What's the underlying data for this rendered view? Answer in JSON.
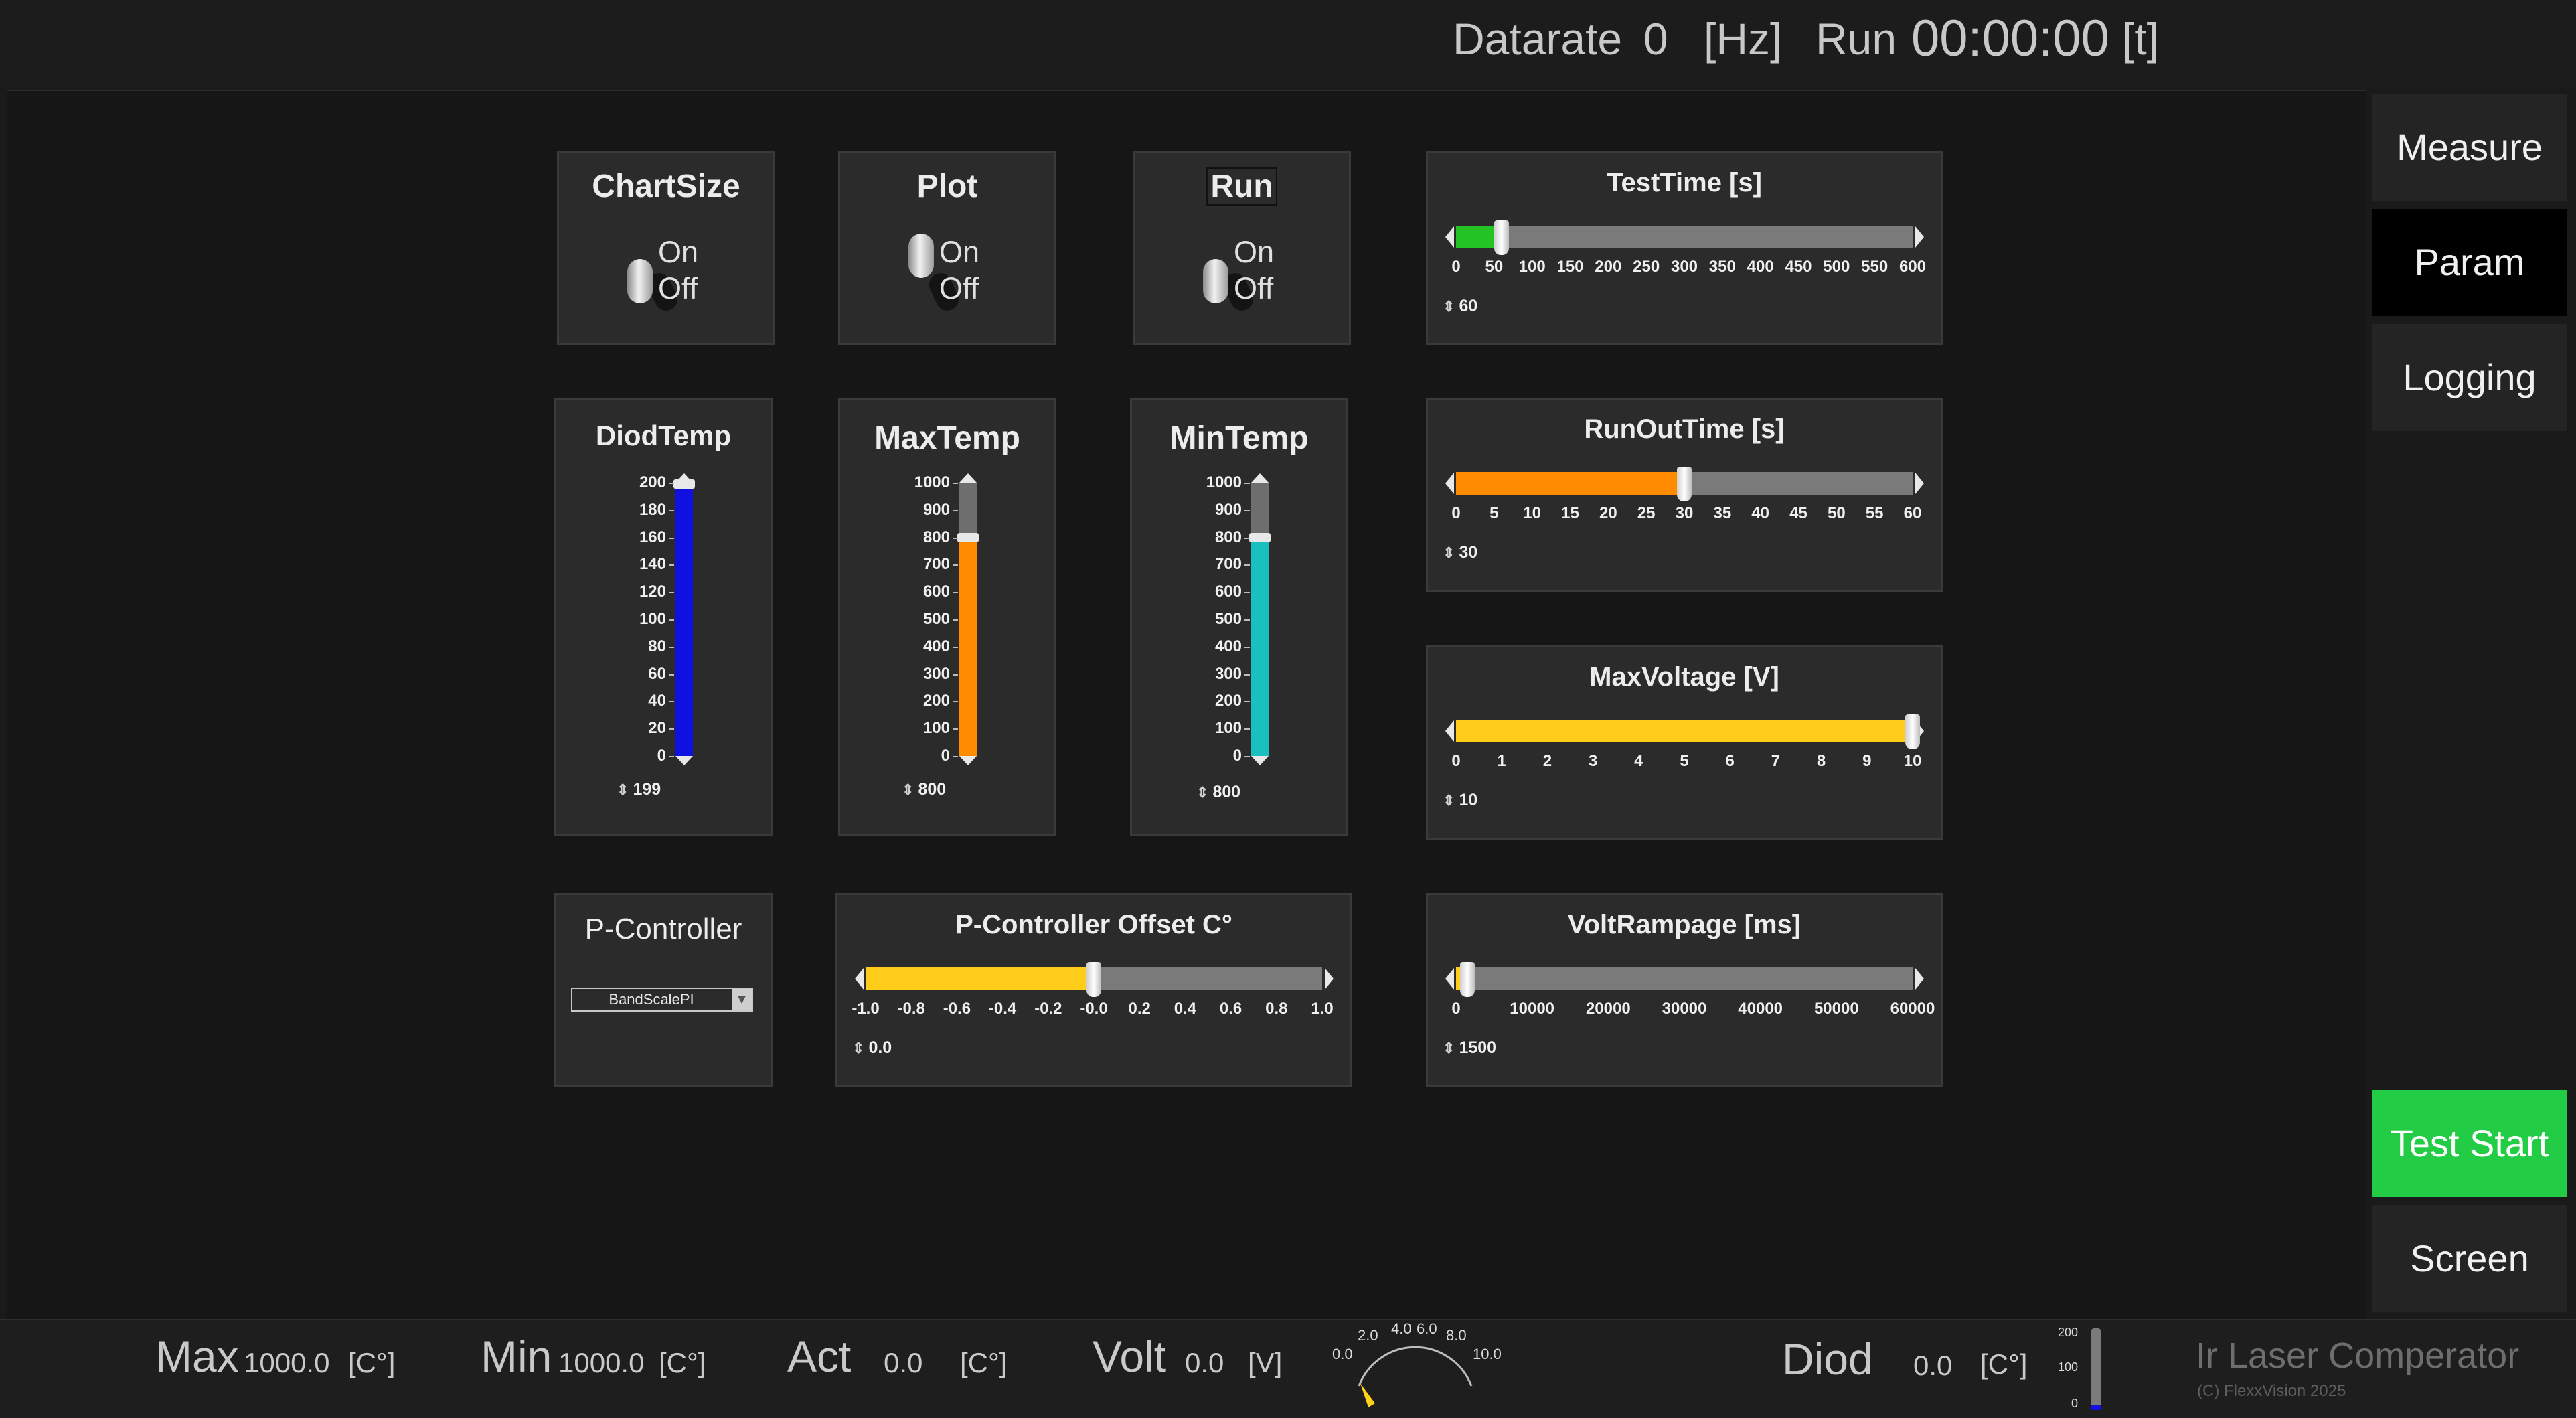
{
  "topbar": {
    "datarate_label": "Datarate",
    "datarate_value": "0",
    "datarate_unit": "[Hz]",
    "run_label": "Run",
    "run_value": "00:00:00",
    "run_unit": "[t]"
  },
  "switches": [
    {
      "title": "ChartSize",
      "on": "On",
      "off": "Off",
      "state": "off"
    },
    {
      "title": "Plot",
      "on": "On",
      "off": "Off",
      "state": "off"
    },
    {
      "title": "Run",
      "on": "On",
      "off": "Off",
      "state": "off"
    }
  ],
  "vbars": [
    {
      "title": "DiodTemp",
      "ticks": [
        "200",
        "180",
        "160",
        "140",
        "120",
        "100",
        "80",
        "60",
        "40",
        "20",
        "0"
      ],
      "min": 0,
      "max": 200,
      "value": 199,
      "value_label": "199",
      "color": "#1010e0"
    },
    {
      "title": "MaxTemp",
      "ticks": [
        "1000",
        "900",
        "800",
        "700",
        "600",
        "500",
        "400",
        "300",
        "200",
        "100",
        "0"
      ],
      "min": 0,
      "max": 1000,
      "value": 800,
      "value_label": "800",
      "color": "#ff8c00"
    },
    {
      "title": "MinTemp",
      "ticks": [
        "1000",
        "900",
        "800",
        "700",
        "600",
        "500",
        "400",
        "300",
        "200",
        "100",
        "0"
      ],
      "min": 0,
      "max": 1000,
      "value": 800,
      "value_label": "800",
      "color": "#1abfbf"
    }
  ],
  "sliders": {
    "testtime": {
      "title": "TestTime [s]",
      "ticks": [
        "0",
        "50",
        "100",
        "150",
        "200",
        "250",
        "300",
        "350",
        "400",
        "450",
        "500",
        "550",
        "600"
      ],
      "min": 0,
      "max": 600,
      "value": 60,
      "value_label": "60",
      "color": "#22c322"
    },
    "runout": {
      "title": "RunOutTime [s]",
      "ticks": [
        "0",
        "5",
        "10",
        "15",
        "20",
        "25",
        "30",
        "35",
        "40",
        "45",
        "50",
        "55",
        "60"
      ],
      "min": 0,
      "max": 60,
      "value": 30,
      "value_label": "30",
      "color": "#ff8c00"
    },
    "maxvolt": {
      "title": "MaxVoltage [V]",
      "ticks": [
        "0",
        "1",
        "2",
        "3",
        "4",
        "5",
        "6",
        "7",
        "8",
        "9",
        "10"
      ],
      "min": 0,
      "max": 10,
      "value": 10,
      "value_label": "10",
      "color": "#ffcc1a"
    },
    "offset": {
      "title": "P-Controller Offset C°",
      "ticks": [
        "-1.0",
        "-0.8",
        "-0.6",
        "-0.4",
        "-0.2",
        "-0.0",
        "0.2",
        "0.4",
        "0.6",
        "0.8",
        "1.0"
      ],
      "min": -1,
      "max": 1,
      "value": 0,
      "value_label": "0.0",
      "color": "#ffcc1a"
    },
    "voltramp": {
      "title": "VoltRampage [ms]",
      "ticks": [
        "0",
        "10000",
        "20000",
        "30000",
        "40000",
        "50000",
        "60000"
      ],
      "min": 0,
      "max": 60000,
      "value": 1500,
      "value_label": "1500",
      "color": "#ffcc1a"
    }
  },
  "pcontroller": {
    "title": "P-Controller",
    "selected": "BandScalePI"
  },
  "nav": {
    "measure": "Measure",
    "param": "Param",
    "logging": "Logging",
    "test_start": "Test Start",
    "screen": "Screen"
  },
  "bottom": {
    "max_label": "Max",
    "max_value": "1000.0",
    "max_unit": "[C°]",
    "min_label": "Min",
    "min_value": "1000.0",
    "min_unit": "[C°]",
    "act_label": "Act",
    "act_value": "0.0",
    "act_unit": "[C°]",
    "volt_label": "Volt",
    "volt_value": "0.0",
    "volt_unit": "[V]",
    "gauge_ticks": [
      "0.0",
      "2.0",
      "4.0",
      "6.0",
      "8.0",
      "10.0"
    ],
    "diod_label": "Diod",
    "diod_value": "0.0",
    "diod_unit": "[C°]",
    "mini_ticks": [
      "200",
      "100",
      "0"
    ],
    "app_title": "Ir Laser Comperator",
    "copyright": "(C) FlexxVision 2025"
  }
}
